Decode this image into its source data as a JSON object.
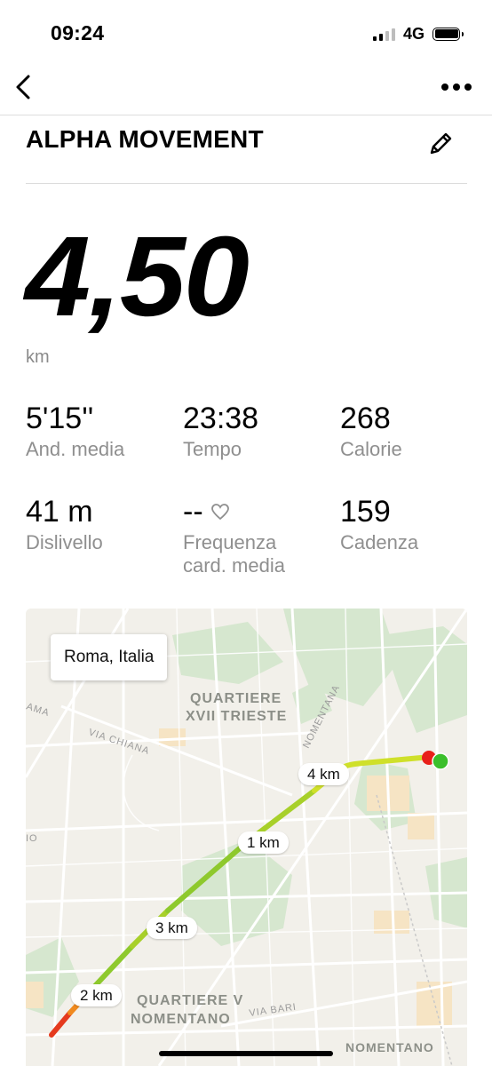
{
  "status_bar": {
    "time": "09:24",
    "network": "4G"
  },
  "header": {
    "title": "ALPHA MOVEMENT"
  },
  "summary": {
    "distance": "4,50",
    "unit": "km"
  },
  "stats": [
    {
      "value": "5'15''",
      "label": "And. media"
    },
    {
      "value": "23:38",
      "label": "Tempo"
    },
    {
      "value": "268",
      "label": "Calorie"
    },
    {
      "value": "41 m",
      "label": "Dislivello"
    },
    {
      "value": "--",
      "label_line1": "Frequenza",
      "label_line2": "card. media"
    },
    {
      "value": "159",
      "label": "Cadenza"
    }
  ],
  "map": {
    "location": "Roma, Italia",
    "district_1_line1": "QUARTIERE",
    "district_1_line2": "XVII TRIESTE",
    "district_2_line1": "QUARTIERE V",
    "district_2_line2": "NOMENTANO",
    "district_3": "NOMENTANO",
    "street_chiana": "VIA CHIANA",
    "street_nomentana": "NOMENTANA",
    "street_bari": "VIA BARI",
    "street_partial_1": "AMA",
    "street_partial_2": "IO",
    "markers": [
      "4 km",
      "1 km",
      "3 km",
      "2 km"
    ],
    "route_colors": {
      "fast": "#cfe02a",
      "mid": "#8ec92d",
      "slow": "#e53a1e",
      "start": "#3bbf2b",
      "end": "#e8201a"
    }
  }
}
